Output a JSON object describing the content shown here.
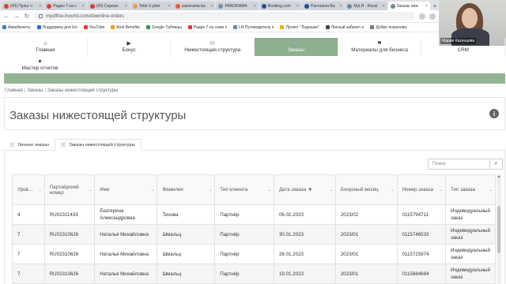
{
  "browser": {
    "tabs": [
      {
        "label": "(43) Пульт ч",
        "color": "#e53935",
        "icon": "youtube-icon"
      },
      {
        "label": "Радио 7 на с",
        "color": "#e53935",
        "icon": "youtube-icon"
      },
      {
        "label": "(43) Сериал",
        "color": "#e53935",
        "icon": "youtube-icon"
      },
      {
        "label": "Tefal X-plorr",
        "color": "#f2a13b",
        "icon": "site-icon"
      },
      {
        "label": "panorama ba",
        "color": "#f05a28",
        "icon": "site-icon"
      },
      {
        "label": "PANORAMA",
        "color": "#7a8fa6",
        "icon": "site-icon"
      },
      {
        "label": "Booking.com",
        "color": "#1e4d9b",
        "icon": "booking-icon"
      },
      {
        "label": "Panorama Ba",
        "color": "#1e4d9b",
        "icon": "booking-icon"
      },
      {
        "label": "MyLR - Russi",
        "color": "#6d8a9a",
        "icon": "site-icon"
      },
      {
        "label": "Заказы ниж",
        "color": "#6d8a9a",
        "icon": "site-icon",
        "active": true
      }
    ],
    "url": "myoffice.lrworld.com/downline-orders",
    "bookmarks": [
      {
        "label": "Авиабилеты",
        "color": "#3d7bd9"
      },
      {
        "label": "Поддержка для Ins",
        "color": "#2a6bd1"
      },
      {
        "label": "YouTube",
        "color": "#e53935"
      },
      {
        "label": "Best Benefits",
        "color": "#f39c12"
      },
      {
        "label": "Google Таблицы",
        "color": "#2e9d4f"
      },
      {
        "label": "Радио 7 на семи х",
        "color": "#e53935"
      },
      {
        "label": "LR Путеводитель п",
        "color": "#6d8a9a"
      },
      {
        "label": "Проект \"Ладошки\"",
        "color": "#f0b400"
      },
      {
        "label": "Личный кабинет н",
        "color": "#444"
      },
      {
        "label": "Добро пожалова",
        "color": "#777"
      }
    ]
  },
  "video": {
    "name": "Мария Казанцева"
  },
  "nav": {
    "items": [
      {
        "label": "Главная",
        "icon": "⌂",
        "icon_name": "home-icon"
      },
      {
        "label": "Бонус",
        "icon": "▶",
        "icon_name": "video-icon"
      },
      {
        "label": "Нижестоящая структура",
        "icon": "⚇",
        "icon_name": "users-icon"
      },
      {
        "label": "Заказы",
        "icon": "🛒",
        "icon_name": "cart-icon",
        "active": true
      },
      {
        "label": "Материалы для бизнеса",
        "icon": "⚑",
        "icon_name": "flag-icon"
      },
      {
        "label": "CRM",
        "icon": "☗",
        "icon_name": "crm-icon"
      }
    ],
    "second_row": {
      "label": "Мастер отчетов",
      "icon": "♥",
      "icon_name": "heart-icon"
    }
  },
  "breadcrumb": [
    "Главная",
    "Заказы",
    "Заказы нижестоящей структуры"
  ],
  "page_title": "Заказы нижестоящей структуры",
  "subtabs": [
    {
      "label": "Личные заказы",
      "icon": "🛒"
    },
    {
      "label": "Заказы нижестоящей структуры",
      "icon": "🛒",
      "active": true
    }
  ],
  "search": {
    "placeholder": "Поиск"
  },
  "table": {
    "columns": [
      "Уров...",
      "Партнёрский номер",
      "Имя",
      "Фамилия",
      "Тип клиента",
      "Дата заказа",
      "Бонусный месяц",
      "Номер заказа",
      "Тип заказа"
    ],
    "sorted_column_marker": "▼",
    "rows": [
      [
        "4",
        "RU02311433",
        "Екатерина Александровна",
        "Тихова",
        "Партнёр",
        "06.02.2023",
        "2023/02",
        "0115794711",
        "Индивидуальный заказ"
      ],
      [
        "7",
        "RU02310626",
        "Наталья Михайловна",
        "Шмальц",
        "Партнёр",
        "30.01.2023",
        "2023/01",
        "0115746533",
        "Индивидуальный заказ"
      ],
      [
        "7",
        "RU02310626",
        "Наталья Михайловна",
        "Шмальц",
        "Партнёр",
        "26.01.2023",
        "2023/01",
        "0115725974",
        "Индивидуальный заказ"
      ],
      [
        "7",
        "RU02310626",
        "Наталья Михайловна",
        "Шмальц",
        "Партнёр",
        "19.01.2023",
        "2023/01",
        "0115684694",
        "Индивидуальный заказ"
      ]
    ]
  }
}
